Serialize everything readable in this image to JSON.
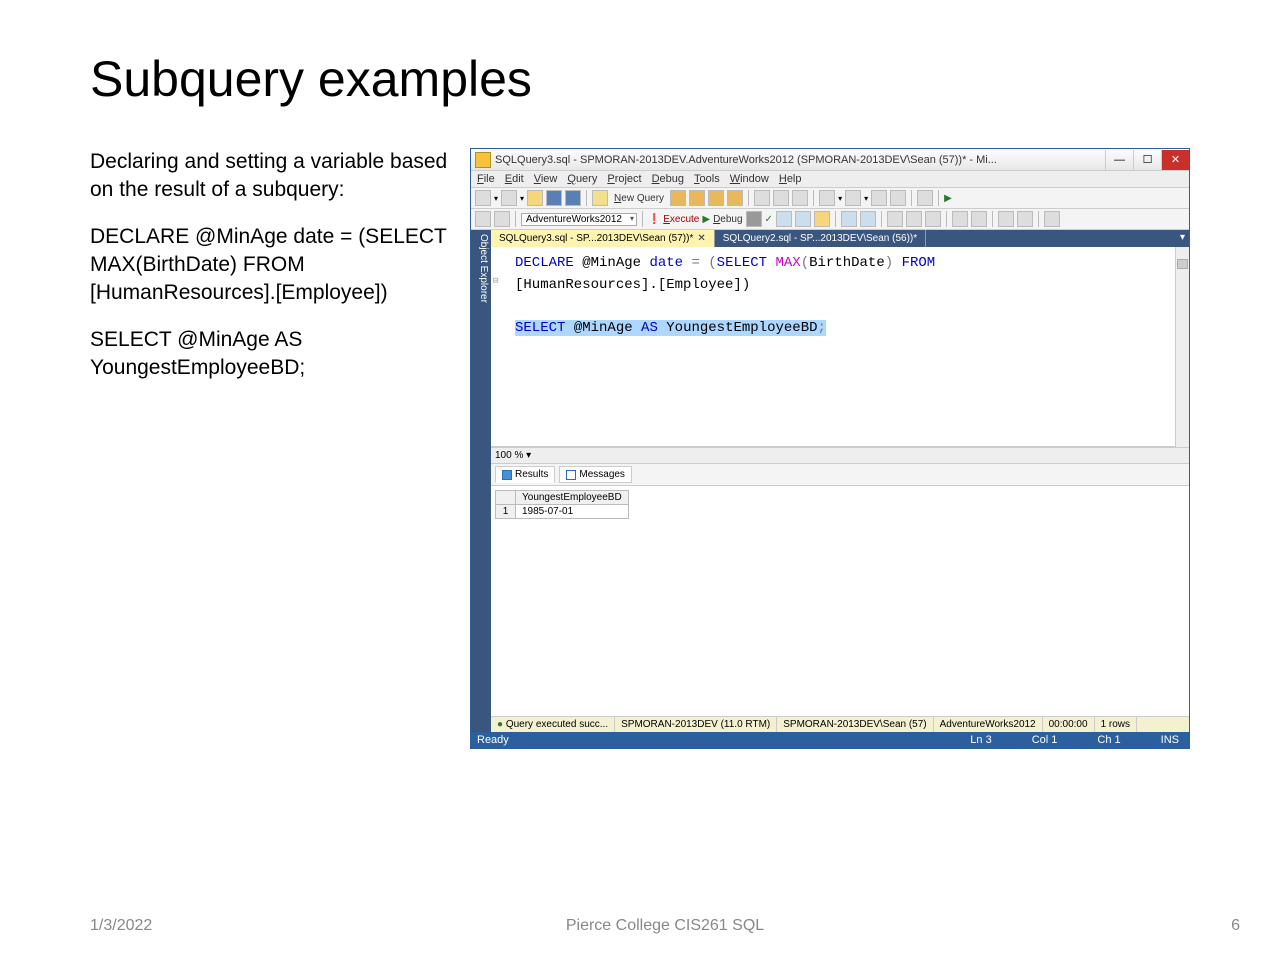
{
  "slide": {
    "title": "Subquery examples",
    "left": {
      "p1": "Declaring and setting a variable based on the result of a subquery:",
      "p2": "DECLARE @MinAge date = (SELECT MAX(BirthDate) FROM [HumanResources].[Employee])",
      "p3": "SELECT @MinAge AS YoungestEmployeeBD;"
    }
  },
  "window": {
    "title": "SQLQuery3.sql - SPMORAN-2013DEV.AdventureWorks2012 (SPMORAN-2013DEV\\Sean (57))* - Mi...",
    "menus": {
      "file": "File",
      "edit": "Edit",
      "view": "View",
      "query": "Query",
      "project": "Project",
      "debug": "Debug",
      "tools": "Tools",
      "window": "Window",
      "help": "Help"
    },
    "newQuery": "New Query",
    "dbName": "AdventureWorks2012",
    "execute": "Execute",
    "debugBtn": "Debug",
    "objExplorer": "Object Explorer",
    "tabs": {
      "active": "SQLQuery3.sql - SP...2013DEV\\Sean (57))*",
      "other": "SQLQuery2.sql - SP...2013DEV\\Sean (56))*"
    },
    "editor": {
      "l1a": "DECLARE",
      "l1b": "@MinAge",
      "l1c": "date",
      "l1d": "=",
      "l1e": "(",
      "l1f": "SELECT",
      "l1g": "MAX",
      "l1h": "(",
      "l1i": "BirthDate",
      "l1j": ")",
      "l1k": "FROM",
      "l2": "[HumanResources].[Employee])",
      "l3a": "SELECT",
      "l3b": "@MinAge",
      "l3c": "AS",
      "l3d": "YoungestEmployeeBD",
      "l3e": ";"
    },
    "zoom": "100 %",
    "resultTabs": {
      "results": "Results",
      "messages": "Messages"
    },
    "results": {
      "col1": "YoungestEmployeeBD",
      "rownum": "1",
      "val1": "1985-07-01"
    },
    "status": {
      "ok": "Query executed succ...",
      "s1": "SPMORAN-2013DEV (11.0 RTM)",
      "s2": "SPMORAN-2013DEV\\Sean (57)",
      "s3": "AdventureWorks2012",
      "s4": "00:00:00",
      "s5": "1 rows"
    },
    "bottom": {
      "ready": "Ready",
      "ln": "Ln 3",
      "col": "Col 1",
      "ch": "Ch 1",
      "ins": "INS"
    }
  },
  "footer": {
    "date": "1/3/2022",
    "center": "Pierce College CIS261 SQL",
    "page": "6"
  }
}
